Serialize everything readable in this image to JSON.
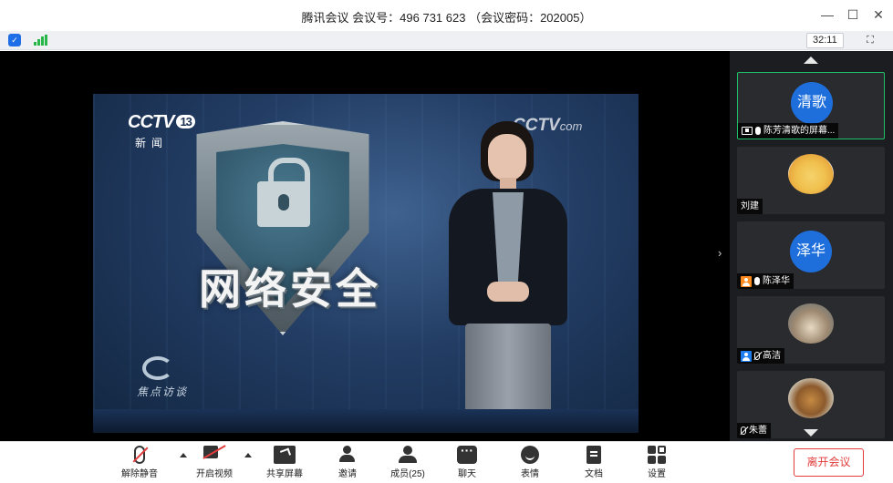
{
  "window": {
    "title": "腾讯会议 会议号：496 731 623 （会议密码：202005）",
    "minimize": "—",
    "maximize": "☐",
    "close": "✕"
  },
  "infobar": {
    "timer": "32:11",
    "fullscreen_glyph": "⛶"
  },
  "shared_video": {
    "channel_logo": "CCTV",
    "channel_number": "13",
    "channel_subtitle": "新闻",
    "corner_logo": "CCTV",
    "corner_logo_suffix": "com",
    "caption": "网络安全",
    "program_logo": "焦点访谈"
  },
  "participants": [
    {
      "avatar_text": "清歌",
      "name": "陈芳清歌的屏幕...",
      "status_icons": [
        "screen-share-icon",
        "mic-icon"
      ],
      "active": true
    },
    {
      "avatar_text": "",
      "name": "刘建",
      "status_icons": [],
      "active": false
    },
    {
      "avatar_text": "泽华",
      "name": "陈泽华",
      "status_icons": [
        "user-icon",
        "mic-icon"
      ],
      "active": false
    },
    {
      "avatar_text": "",
      "name": "高洁",
      "status_icons": [
        "user-icon",
        "mic-off-icon"
      ],
      "active": false
    },
    {
      "avatar_text": "",
      "name": "朱蕾",
      "status_icons": [
        "mic-off-icon"
      ],
      "active": false
    }
  ],
  "toolbar": {
    "unmute": "解除静音",
    "start_video": "开启视频",
    "share_screen": "共享屏幕",
    "invite": "邀请",
    "members": "成员(25)",
    "chat": "聊天",
    "reactions": "表情",
    "documents": "文档",
    "settings": "设置",
    "leave": "离开会议"
  },
  "colors": {
    "accent_blue": "#1e6fdc",
    "leave_red": "#e23c3c",
    "active_green": "#1fc06a",
    "signal_green": "#27b648"
  }
}
